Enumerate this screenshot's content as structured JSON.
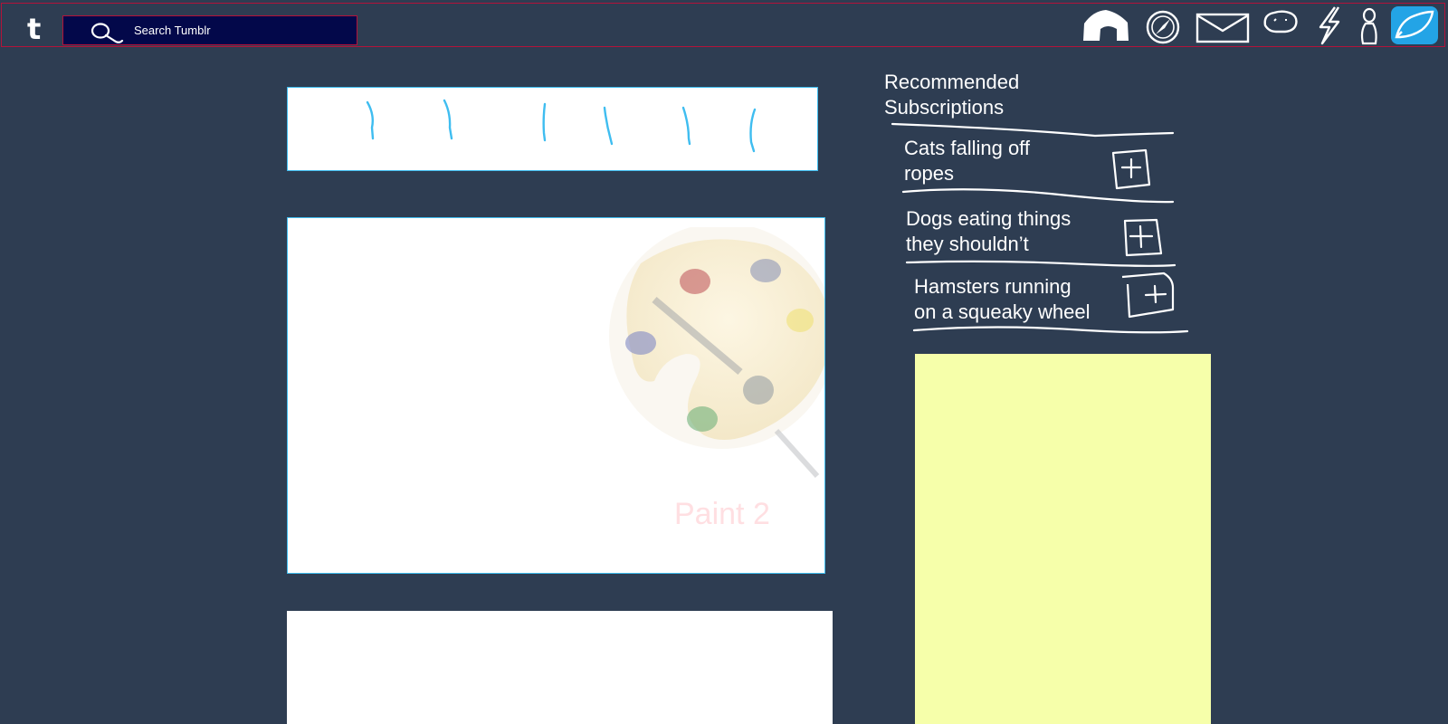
{
  "topbar": {
    "logo": "t",
    "search": {
      "placeholder": "Search Tumblr"
    },
    "nav_icons": [
      "home-icon",
      "explore-compass-icon",
      "mail-icon",
      "chat-bubble-icon",
      "activity-lightning-icon",
      "account-person-icon",
      "compose-pen-icon"
    ]
  },
  "feed": {
    "image_post_caption": "Paint 2"
  },
  "sidebar": {
    "title": "Recommended Subscriptions",
    "items": [
      {
        "name": "Cats falling off ropes",
        "line1": "Cats falling off",
        "line2": "ropes"
      },
      {
        "name": "Dogs eating things they shouldn’t",
        "line1": "Dogs eating things",
        "line2": "they shouldn’t"
      },
      {
        "name": "Hamsters running on a squeaky wheel",
        "line1": "Hamsters running",
        "line2": "on a squeaky wheel"
      }
    ]
  },
  "colors": {
    "background": "#2e3d52",
    "border_red": "#b3133a",
    "search_bg": "#03084a",
    "accent_blue": "#3fbdf0",
    "active_icon_bg": "#23a4e6",
    "ad_yellow": "#f6ffaa"
  }
}
